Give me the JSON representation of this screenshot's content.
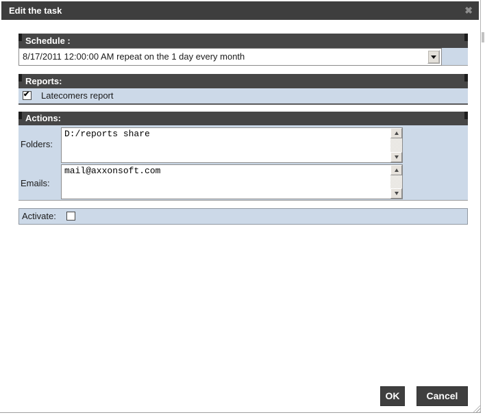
{
  "dialog": {
    "title": "Edit the task",
    "close_glyph": "✖"
  },
  "schedule": {
    "header": "Schedule :",
    "value": "8/17/2011 12:00:00 AM repeat on the 1 day every month"
  },
  "reports": {
    "header": "Reports:",
    "item": {
      "label": "Latecomers report",
      "checked": true,
      "check_glyph": "✔"
    }
  },
  "actions": {
    "header": "Actions:",
    "folders": {
      "label": "Folders:",
      "value": "D:/reports share"
    },
    "emails": {
      "label": "Emails:",
      "value": "mail@axxonsoft.com"
    }
  },
  "activate": {
    "label": "Activate:",
    "checked": false
  },
  "footer": {
    "ok_label": "OK",
    "cancel_label": "Cancel"
  },
  "colors": {
    "titlebar_bg": "#3e3e3e",
    "section_header_bg": "#464646",
    "panel_bg": "#ccd9e8",
    "button_bg": "#3f3f3f"
  }
}
